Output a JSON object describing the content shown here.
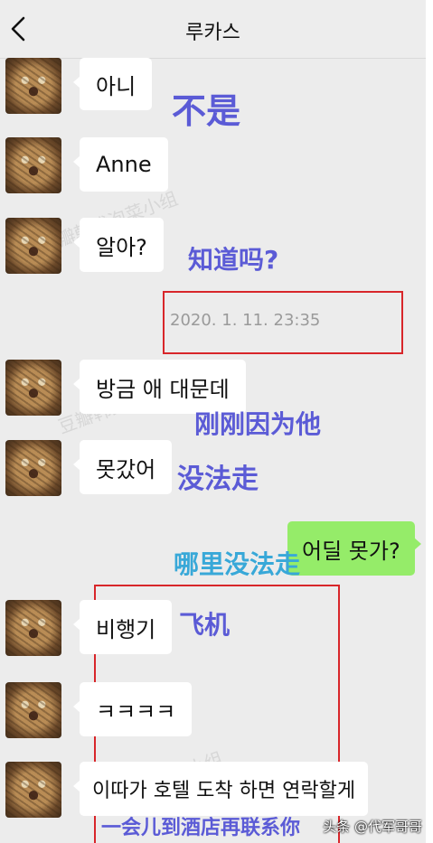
{
  "header": {
    "title": "루카스"
  },
  "messages": [
    {
      "text": "아니",
      "translation": "不是"
    },
    {
      "text": "Anne"
    },
    {
      "text": "알아?",
      "translation": "知道吗?"
    },
    {
      "text": "방금 애 대문데",
      "translation": "刚刚因为他"
    },
    {
      "text": "못갔어",
      "translation": "没法走"
    },
    {
      "text": "비행기",
      "translation": "飞机"
    },
    {
      "text": "ㅋㅋㅋㅋ"
    },
    {
      "text": "이따가 호텔 도착 하면 연락할게",
      "translation": "一会儿到酒店再联系你"
    }
  ],
  "timestamp": "2020. 1. 11. 23:35",
  "outgoing": {
    "text": "어딜 못가?",
    "translation": "哪里没法走"
  },
  "watermark": "豆瓣韩式泡菜小组",
  "credit": "头条 @代军哥哥",
  "colors": {
    "outgoing_bubble": "#95ec69",
    "annotation": "#5b5bd6",
    "annotation_teal": "#38a8d8",
    "highlight_box": "#d8262a"
  }
}
